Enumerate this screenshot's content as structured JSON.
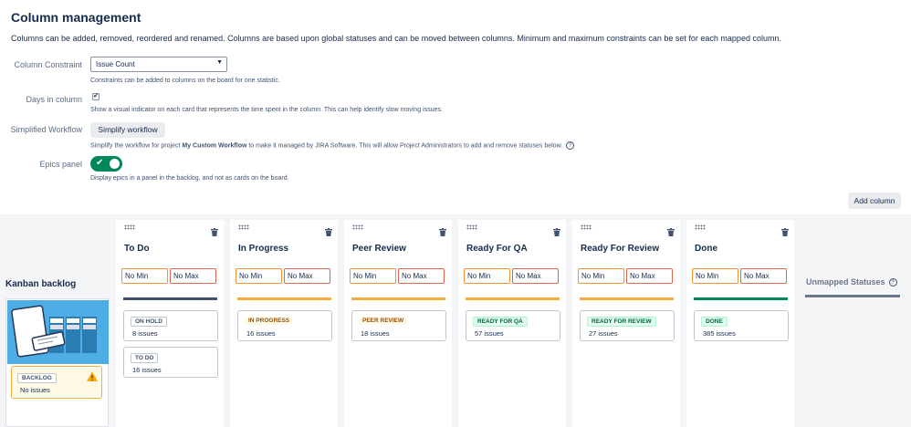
{
  "page": {
    "title": "Column management",
    "description": "Columns can be added, removed, reordered and renamed. Columns are based upon global statuses and can be moved between columns. Minimum and maximum constraints can be set for each mapped column."
  },
  "settings": {
    "column_constraint": {
      "label": "Column Constraint",
      "value": "Issue Count",
      "help": "Constraints can be added to columns on the board for one statistic."
    },
    "days_in_column": {
      "label": "Days in column",
      "checked": true,
      "check_glyph": "✔",
      "help": "Show a visual indicator on each card that represents the time spent in the column. This can help identify slow moving issues."
    },
    "simplified_workflow": {
      "label": "Simplified Workflow",
      "button": "Simplify workflow",
      "help_before": "Simplify the workflow for project ",
      "help_project": "My Custom Workflow",
      "help_after": " to make it managed by JIRA Software. This will allow Project Administrators to add and remove statuses below.",
      "help_icon": "?"
    },
    "epics_panel": {
      "label": "Epics panel",
      "enabled": true,
      "toggle_glyph": "✔",
      "help": "Display epics in a panel in the backlog, and not as cards on the board."
    }
  },
  "toolbar": {
    "add_column": "Add column"
  },
  "backlog": {
    "title": "Kanban backlog",
    "card": {
      "status": "BACKLOG",
      "count": "No issues",
      "warning_icon": "!"
    }
  },
  "colors": {
    "new": "#42526e",
    "in_progress": "#f6ad3c",
    "done": "#00875a",
    "min_border": "#f79232",
    "max_border": "#e0654b"
  },
  "columns": [
    {
      "name": "To Do",
      "min": "No Min",
      "max": "No Max",
      "bar": "#42526e",
      "cards": [
        {
          "status": "ON HOLD",
          "count": "8 issues",
          "category": "new"
        },
        {
          "status": "TO DO",
          "count": "16 issues",
          "category": "new"
        }
      ]
    },
    {
      "name": "In Progress",
      "min": "No Min",
      "max": "No Max",
      "bar": "#f6ad3c",
      "cards": [
        {
          "status": "IN PROGRESS",
          "count": "16 issues",
          "category": "prog"
        }
      ]
    },
    {
      "name": "Peer Review",
      "min": "No Min",
      "max": "No Max",
      "bar": "#f6ad3c",
      "cards": [
        {
          "status": "PEER REVIEW",
          "count": "18 issues",
          "category": "prog"
        }
      ]
    },
    {
      "name": "Ready For QA",
      "min": "No Min",
      "max": "No Max",
      "bar": "#f6ad3c",
      "cards": [
        {
          "status": "READY FOR QA",
          "count": "57 issues",
          "category": "done"
        }
      ]
    },
    {
      "name": "Ready For Review",
      "min": "No Min",
      "max": "No Max",
      "bar": "#f6ad3c",
      "cards": [
        {
          "status": "READY FOR REVIEW",
          "count": "27 issues",
          "category": "done"
        }
      ]
    },
    {
      "name": "Done",
      "min": "No Min",
      "max": "No Max",
      "bar": "#00875a",
      "cards": [
        {
          "status": "DONE",
          "count": "385 issues",
          "category": "done"
        }
      ]
    }
  ],
  "unmapped": {
    "title": "Unmapped Statuses",
    "help_icon": "?"
  }
}
